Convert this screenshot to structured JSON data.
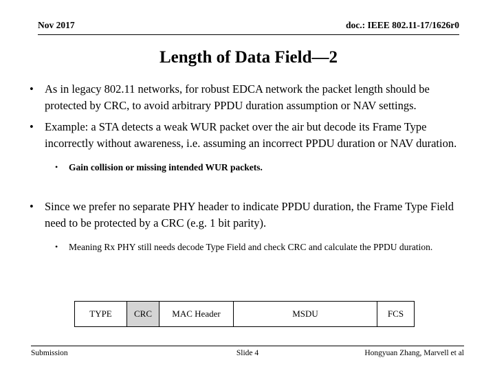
{
  "header": {
    "date": "Nov 2017",
    "doc": "doc.: IEEE 802.11-17/1626r0"
  },
  "title": "Length of Data Field—2",
  "bullet_marker": "•",
  "body": {
    "bullets": [
      {
        "level": 1,
        "text": "As in legacy 802.11 networks, for robust EDCA network the packet length should be protected by CRC, to avoid arbitrary PPDU duration assumption or NAV settings."
      },
      {
        "level": 1,
        "text": "Example: a STA detects a weak WUR packet over the air but decode its Frame Type incorrectly without awareness, i.e. assuming an incorrect PPDU duration or NAV duration."
      },
      {
        "level": 2,
        "text": "Gain collision or missing intended WUR packets."
      },
      {
        "level": 1,
        "text": "Since we prefer no separate PHY header to indicate PPDU duration, the Frame Type Field need to be protected by a CRC (e.g. 1 bit parity)."
      },
      {
        "level": 2,
        "text": "Meaning Rx PHY still needs decode Type Field and check CRC and calculate the PPDU duration."
      }
    ]
  },
  "frame_format": {
    "cells": [
      {
        "label": "TYPE",
        "shaded": false
      },
      {
        "label": "CRC",
        "shaded": true
      },
      {
        "label": "MAC Header",
        "shaded": false
      },
      {
        "label": "MSDU",
        "shaded": false
      },
      {
        "label": "FCS",
        "shaded": false
      }
    ],
    "shade_color": "#d4d4d4"
  },
  "footer": {
    "left": "Submission",
    "center": "Slide 4",
    "right": "Hongyuan Zhang, Marvell et al"
  }
}
